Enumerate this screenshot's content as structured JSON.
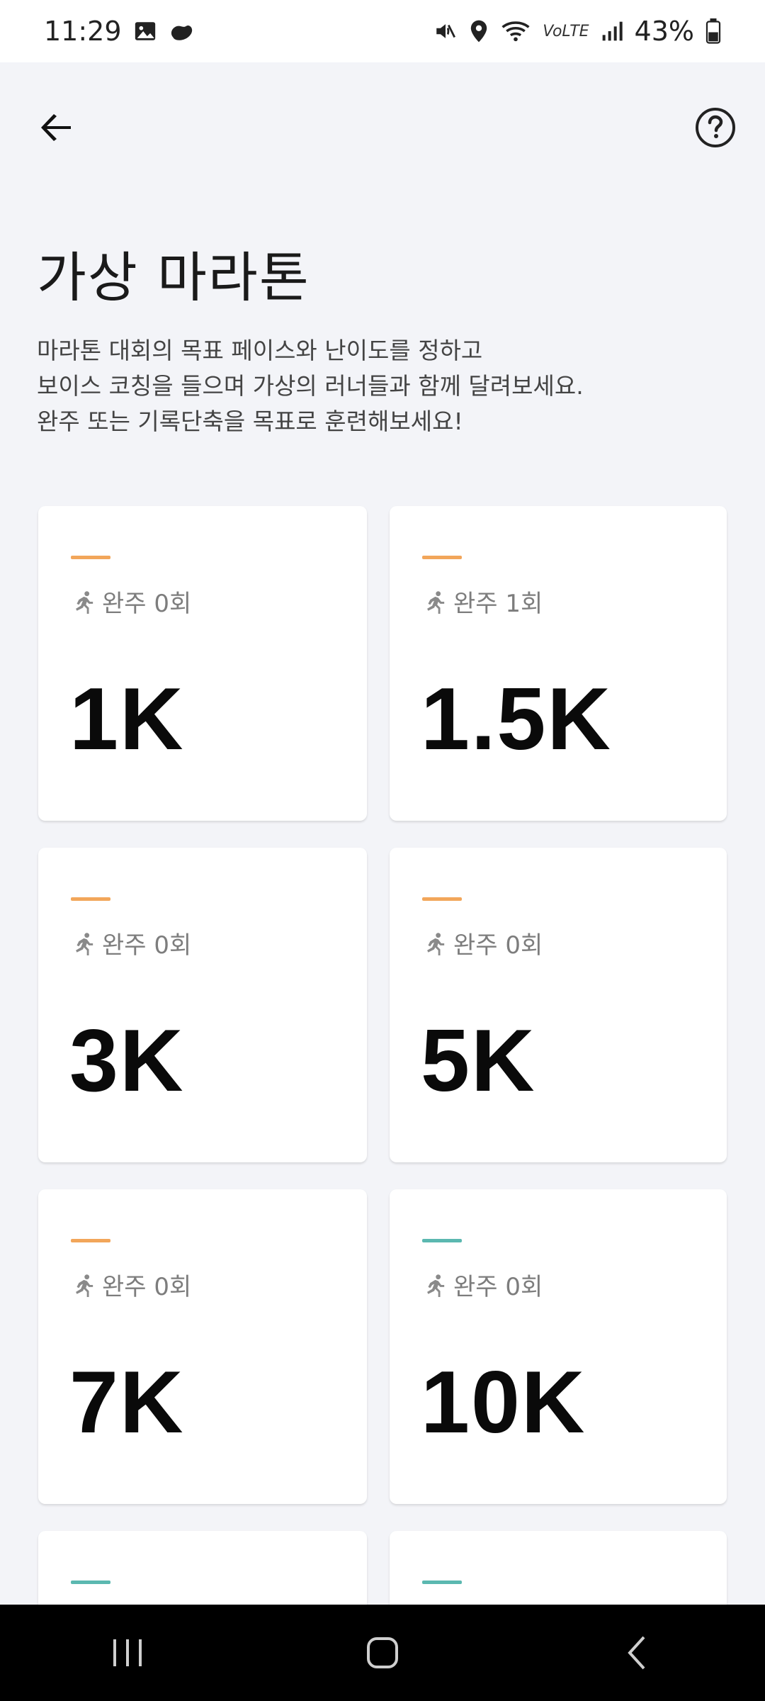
{
  "status_bar": {
    "time": "11:29",
    "battery": "43%",
    "network_label": "VoLTE",
    "icons": [
      "gallery-icon",
      "app-notification-icon",
      "mute-icon",
      "location-icon",
      "wifi-icon",
      "signal-icon",
      "battery-icon"
    ]
  },
  "header": {
    "back_icon": "arrow-left-icon",
    "help_icon": "question-circle-icon"
  },
  "page": {
    "title": "가상 마라톤",
    "description": [
      "마라톤 대회의 목표 페이스와 난이도를 정하고",
      "보이스 코칭을 들으며 가상의 러너들과 함께 달려보세요.",
      "완주 또는 기록단축을 목표로 훈련해보세요!"
    ]
  },
  "cards": [
    {
      "distance": "1K",
      "completion": "완주 0회",
      "accent": "#f2a65a"
    },
    {
      "distance": "1.5K",
      "completion": "완주 1회",
      "accent": "#f2a65a"
    },
    {
      "distance": "3K",
      "completion": "완주 0회",
      "accent": "#f2a65a"
    },
    {
      "distance": "5K",
      "completion": "완주 0회",
      "accent": "#f2a65a"
    },
    {
      "distance": "7K",
      "completion": "완주 0회",
      "accent": "#f2a65a"
    },
    {
      "distance": "10K",
      "completion": "완주 0회",
      "accent": "#5bb8b0"
    }
  ],
  "partial_cards": [
    {
      "accent": "#5bb8b0"
    },
    {
      "accent": "#5bb8b0"
    }
  ],
  "navbar": {
    "icons": [
      "recent-apps-icon",
      "home-icon",
      "back-icon"
    ]
  }
}
